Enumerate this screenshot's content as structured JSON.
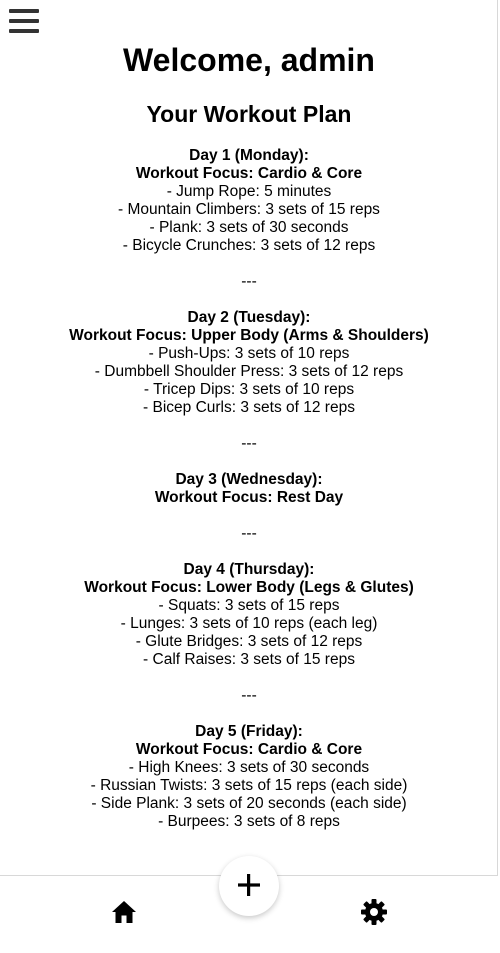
{
  "header": {
    "welcome": "Welcome, admin",
    "plan_title": "Your Workout Plan"
  },
  "plan_lines": [
    {
      "text": "Day 1 (Monday):",
      "bold": true
    },
    {
      "text": "Workout Focus: Cardio & Core",
      "bold": true
    },
    {
      "text": "- Jump Rope: 5 minutes",
      "bold": false
    },
    {
      "text": "- Mountain Climbers: 3 sets of 15 reps",
      "bold": false
    },
    {
      "text": "- Plank: 3 sets of 30 seconds",
      "bold": false
    },
    {
      "text": "- Bicycle Crunches: 3 sets of 12 reps",
      "bold": false
    },
    {
      "text": "",
      "bold": false
    },
    {
      "text": "---",
      "bold": false
    },
    {
      "text": "",
      "bold": false
    },
    {
      "text": "Day 2 (Tuesday):",
      "bold": true
    },
    {
      "text": "Workout Focus: Upper Body (Arms & Shoulders)",
      "bold": true
    },
    {
      "text": "- Push-Ups: 3 sets of 10 reps",
      "bold": false
    },
    {
      "text": "- Dumbbell Shoulder Press: 3 sets of 12 reps",
      "bold": false
    },
    {
      "text": "- Tricep Dips: 3 sets of 10 reps",
      "bold": false
    },
    {
      "text": "- Bicep Curls: 3 sets of 12 reps",
      "bold": false
    },
    {
      "text": "",
      "bold": false
    },
    {
      "text": "---",
      "bold": false
    },
    {
      "text": "",
      "bold": false
    },
    {
      "text": "Day 3 (Wednesday):",
      "bold": true
    },
    {
      "text": "Workout Focus: Rest Day",
      "bold": true
    },
    {
      "text": "",
      "bold": false
    },
    {
      "text": "---",
      "bold": false
    },
    {
      "text": "",
      "bold": false
    },
    {
      "text": "Day 4 (Thursday):",
      "bold": true
    },
    {
      "text": "Workout Focus: Lower Body (Legs & Glutes)",
      "bold": true
    },
    {
      "text": "- Squats: 3 sets of 15 reps",
      "bold": false
    },
    {
      "text": "- Lunges: 3 sets of 10 reps (each leg)",
      "bold": false
    },
    {
      "text": "- Glute Bridges: 3 sets of 12 reps",
      "bold": false
    },
    {
      "text": "- Calf Raises: 3 sets of 15 reps",
      "bold": false
    },
    {
      "text": "",
      "bold": false
    },
    {
      "text": "---",
      "bold": false
    },
    {
      "text": "",
      "bold": false
    },
    {
      "text": "Day 5 (Friday):",
      "bold": true
    },
    {
      "text": "Workout Focus: Cardio & Core",
      "bold": true
    },
    {
      "text": "- High Knees: 3 sets of 30 seconds",
      "bold": false
    },
    {
      "text": "- Russian Twists: 3 sets of 15 reps (each side)",
      "bold": false
    },
    {
      "text": "- Side Plank: 3 sets of 20 seconds (each side)",
      "bold": false
    },
    {
      "text": "- Burpees: 3 sets of 8 reps",
      "bold": false
    }
  ],
  "icons": {
    "menu": "hamburger-menu-icon",
    "add": "plus-icon",
    "home": "home-icon",
    "settings": "gear-icon"
  },
  "colors": {
    "background": "#ffffff",
    "text": "#000000",
    "menu_icon": "#333333",
    "divider": "#d8d8d8"
  }
}
